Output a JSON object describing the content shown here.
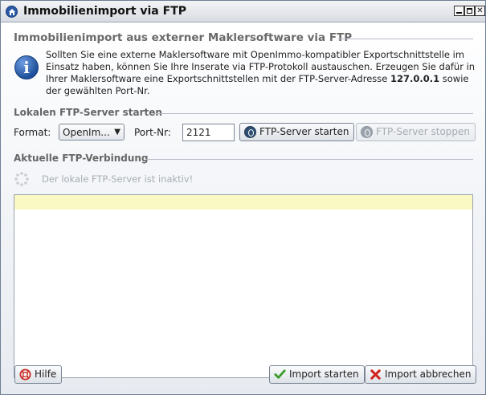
{
  "window": {
    "title": "Immobilienimport via FTP",
    "controls": [
      "minimize",
      "maximize",
      "close"
    ]
  },
  "intro": {
    "heading": "Immobilienimport aus externer Maklersoftware via FTP",
    "text_1": "Sollten Sie eine externe Maklersoftware mit OpenImmo-kompatibler Exportschnittstelle im Einsatz haben, können Sie Ihre Inserate via FTP-Protokoll austauschen. Erzeugen Sie dafür in Ihrer Maklersoftware eine Exportschnittstellen mit der FTP-Server-Adresse ",
    "address": "127.0.0.1",
    "text_2": " sowie der gewählten Port-Nr."
  },
  "local_server": {
    "heading": "Lokalen FTP-Server starten",
    "format_label": "Format:",
    "format_value": "OpenIm...",
    "port_label": "Port-Nr:",
    "port_value": "2121",
    "start_label": "FTP-Server starten",
    "stop_label": "FTP-Server stoppen"
  },
  "connection": {
    "heading": "Aktuelle FTP-Verbindung",
    "status": "Der lokale FTP-Server ist inaktiv!"
  },
  "footer": {
    "help_label": "Hilfe",
    "import_start_label": "Import starten",
    "import_abort_label": "Import abbrechen"
  },
  "colors": {
    "accent": "#2b5aa6",
    "log_highlight": "#fbf9c3",
    "abort_icon": "#d0211a",
    "start_icon": "#3a9a2a"
  }
}
